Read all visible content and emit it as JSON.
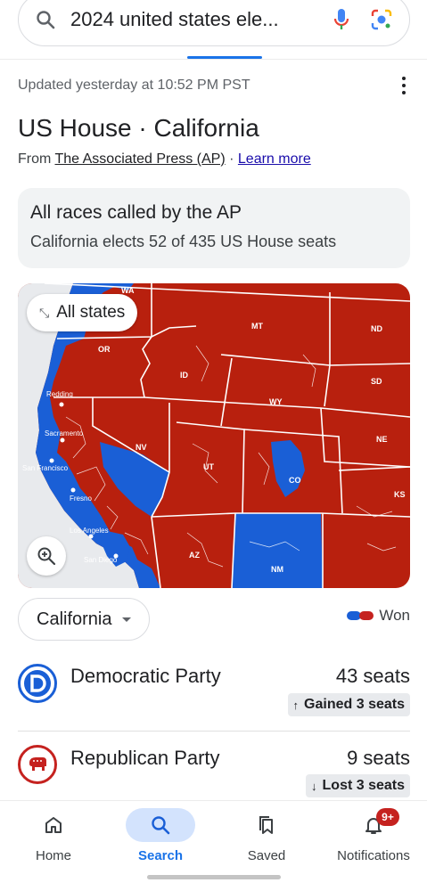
{
  "search": {
    "query": "2024 united states ele...",
    "icons": [
      "search-icon",
      "mic-icon",
      "lens-icon"
    ]
  },
  "result": {
    "updated": "Updated yesterday at 10:52 PM PST",
    "title": "US House · California",
    "source_prefix": "From ",
    "source_name": "The Associated Press (AP)",
    "source_sep": " · ",
    "learn_more": "Learn more"
  },
  "called_box": {
    "heading": "All races called by the AP",
    "subtext": "California elects 52 of 435 US House seats"
  },
  "map": {
    "all_states_label": "All states",
    "state_labels": [
      "WA",
      "MT",
      "ND",
      "OR",
      "ID",
      "SD",
      "WY",
      "NE",
      "NV",
      "UT",
      "CO",
      "KS",
      "AZ",
      "NM"
    ],
    "city_labels": [
      "Redding",
      "Sacramento",
      "San Francisco",
      "Fresno",
      "Los Angeles",
      "San Diego"
    ],
    "colors": {
      "democrat": "#1a5fd6",
      "republican": "#b8200e",
      "border": "#ffffff"
    }
  },
  "filter": {
    "selected_state": "California",
    "legend_label": "Won",
    "legend_colors": [
      "#1a5fd6",
      "#c5221f"
    ]
  },
  "parties": [
    {
      "name": "Democratic Party",
      "seats": "43 seats",
      "change": "Gained 3 seats",
      "direction": "up",
      "color": "#1a5fd6",
      "logo": "democrat-d-icon"
    },
    {
      "name": "Republican Party",
      "seats": "9 seats",
      "change": "Lost 3 seats",
      "direction": "down",
      "color": "#c5221f",
      "logo": "republican-elephant-icon"
    }
  ],
  "bottom_nav": {
    "items": [
      {
        "label": "Home",
        "icon": "home-icon",
        "active": false
      },
      {
        "label": "Search",
        "icon": "search-icon",
        "active": true
      },
      {
        "label": "Saved",
        "icon": "bookmarks-icon",
        "active": false
      },
      {
        "label": "Notifications",
        "icon": "bell-icon",
        "active": false,
        "badge": "9+"
      }
    ]
  }
}
